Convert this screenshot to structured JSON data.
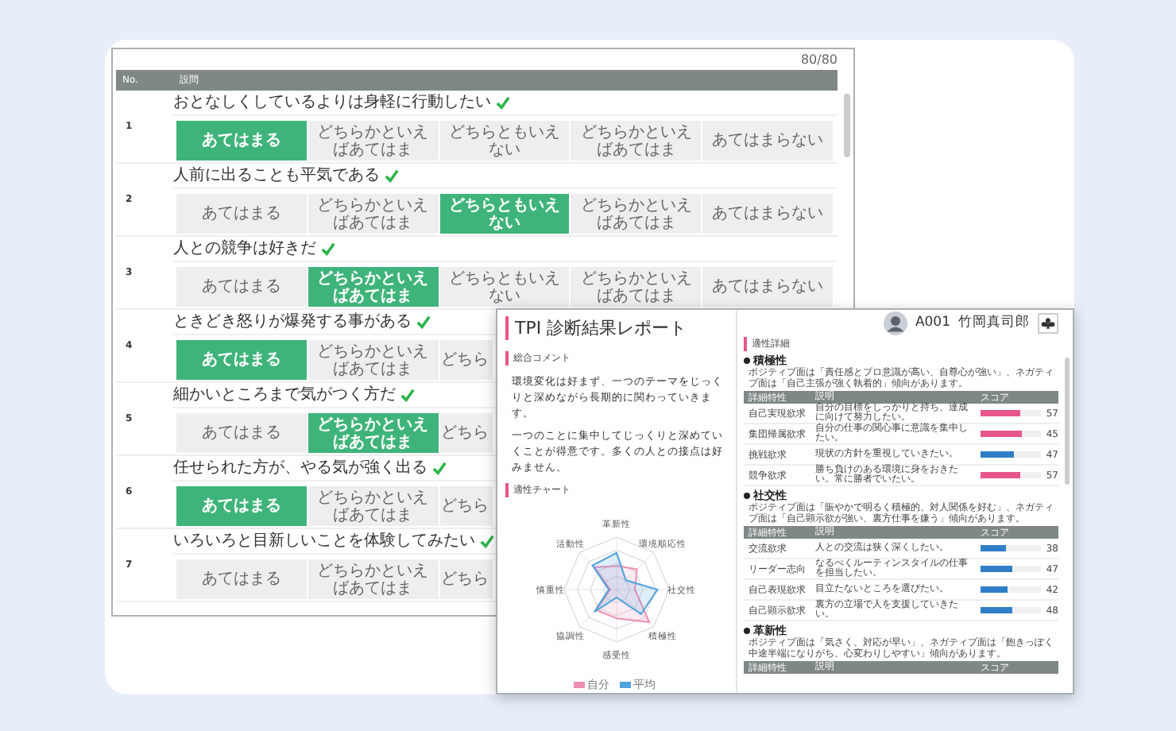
{
  "questionnaire": {
    "counter": "80/80",
    "columns": [
      "No.",
      "設問"
    ],
    "questions": [
      {
        "number": "1",
        "text": "おとなしくしているよりは身軽に行動したい",
        "answered": true,
        "options": [
          {
            "label": "あてはまる",
            "selected": true
          },
          {
            "label": "どちらかといえばあてはま",
            "selected": false
          },
          {
            "label": "どちらともいえない",
            "selected": false
          },
          {
            "label": "どちらかといえばあてはま",
            "selected": false
          },
          {
            "label": "あてはまらない",
            "selected": false
          }
        ]
      },
      {
        "number": "2",
        "text": "人前に出ることも平気である",
        "answered": true,
        "options": [
          {
            "label": "あてはまる",
            "selected": false
          },
          {
            "label": "どちらかといえばあてはま",
            "selected": false
          },
          {
            "label": "どちらともいえない",
            "selected": true
          },
          {
            "label": "どちらかといえばあてはま",
            "selected": false
          },
          {
            "label": "あてはまらない",
            "selected": false
          }
        ]
      },
      {
        "number": "3",
        "text": "人との競争は好きだ",
        "answered": true,
        "options": [
          {
            "label": "あてはまる",
            "selected": false
          },
          {
            "label": "どちらかといえばあてはま",
            "selected": true
          },
          {
            "label": "どちらともいえない",
            "selected": false
          },
          {
            "label": "どちらかといえばあてはま",
            "selected": false
          },
          {
            "label": "あてはまらない",
            "selected": false
          }
        ]
      },
      {
        "number": "4",
        "text": "ときどき怒りが爆発する事がある",
        "answered": true,
        "options": [
          {
            "label": "あてはまる",
            "selected": true
          },
          {
            "label": "どちらかといえばあてはま",
            "selected": false
          },
          {
            "label": "どちら",
            "selected": false
          }
        ]
      },
      {
        "number": "5",
        "text": "細かいところまで気がつく方だ",
        "answered": true,
        "options": [
          {
            "label": "あてはまる",
            "selected": false
          },
          {
            "label": "どちらかといえばあてはま",
            "selected": true
          },
          {
            "label": "どちら",
            "selected": false
          }
        ]
      },
      {
        "number": "6",
        "text": "任せられた方が、やる気が強く出る",
        "answered": true,
        "options": [
          {
            "label": "あてはまる",
            "selected": true
          },
          {
            "label": "どちらかといえばあてはま",
            "selected": false
          },
          {
            "label": "どちら",
            "selected": false
          }
        ]
      },
      {
        "number": "7",
        "text": "いろいろと目新しいことを体験してみたい",
        "answered": true,
        "options": [
          {
            "label": "あてはまる",
            "selected": false
          },
          {
            "label": "どちらかといえばあてはま",
            "selected": false
          },
          {
            "label": "どちら",
            "selected": false
          }
        ]
      }
    ]
  },
  "report": {
    "title": "TPI 診断結果レポート",
    "user": {
      "id": "A001",
      "name": "竹岡真司郎"
    },
    "summary": {
      "heading": "総合コメント",
      "paragraphs": [
        "環境変化は好まず、一つのテーマをじっくりと深めながら長期的に関わっていきます。",
        "一つのことに集中してじっくりと深めていくことが得意です。多くの人との接点は好みません。"
      ]
    },
    "chart": {
      "heading": "適性チャート",
      "axes": [
        "革新性",
        "環境順応性",
        "社交性",
        "積極性",
        "感受性",
        "協調性",
        "慎重性",
        "活動性"
      ],
      "legend": [
        {
          "label": "自分",
          "color": "#ef8fb5"
        },
        {
          "label": "平均",
          "color": "#4fa3dd"
        }
      ]
    },
    "details": {
      "heading": "適性詳細",
      "sections": [
        {
          "name": "積極性",
          "description": "ポジティブ面は「責任感とプロ意識が高い、自尊心が強い」、ネガティブ面は「自己主張が強く執着的」傾向があります。",
          "columns": [
            "詳細特性",
            "説明",
            "スコア"
          ],
          "rows": [
            {
              "trait": "自己実現欲求",
              "description": "自分の目標をしっかりと持ち、達成に向けて努力したい。",
              "score": "57",
              "level": 0.65,
              "color": "#e6558c"
            },
            {
              "trait": "集団帰属欲求",
              "description": "自分の仕事の関心事に意識を集中したい。",
              "score": "45",
              "level": 0.68,
              "color": "#e6558c"
            },
            {
              "trait": "挑戦欲求",
              "description": "現状の方針を重視していきたい。",
              "score": "47",
              "level": 0.55,
              "color": "#2f7ec6"
            },
            {
              "trait": "競争欲求",
              "description": "勝ち負けのある環境に身をおきたい。常に勝者でいたい。",
              "score": "57",
              "level": 0.65,
              "color": "#e6558c"
            }
          ]
        },
        {
          "name": "社交性",
          "description": "ポジティブ面は「賑やかで明るく積極的、対人関係を好む」、ネガティブ面は「自己顕示欲が強い、裏方仕事を嫌う」傾向があります。",
          "columns": [
            "詳細特性",
            "説明",
            "スコア"
          ],
          "rows": [
            {
              "trait": "交流欲求",
              "description": "人との交流は狭く深くしたい。",
              "score": "38",
              "level": 0.42,
              "color": "#2f7ec6"
            },
            {
              "trait": "リーダー志向",
              "description": "なるべくルーティンスタイルの仕事を担当したい。",
              "score": "47",
              "level": 0.52,
              "color": "#2f7ec6"
            },
            {
              "trait": "自己表現欲求",
              "description": "目立たないところを選びたい。",
              "score": "42",
              "level": 0.45,
              "color": "#2f7ec6"
            },
            {
              "trait": "自己顕示欲求",
              "description": "裏方の立場で人を支援していきたい。",
              "score": "48",
              "level": 0.52,
              "color": "#2f7ec6"
            }
          ]
        },
        {
          "name": "革新性",
          "description": "ポジティブ面は「気さく、対応が早い」、ネガティブ面は「飽きっぽく中途半端になりがち、心変わりしやすい」傾向があります。",
          "columns": [
            "詳細特性",
            "説明",
            "スコア"
          ]
        }
      ]
    }
  }
}
